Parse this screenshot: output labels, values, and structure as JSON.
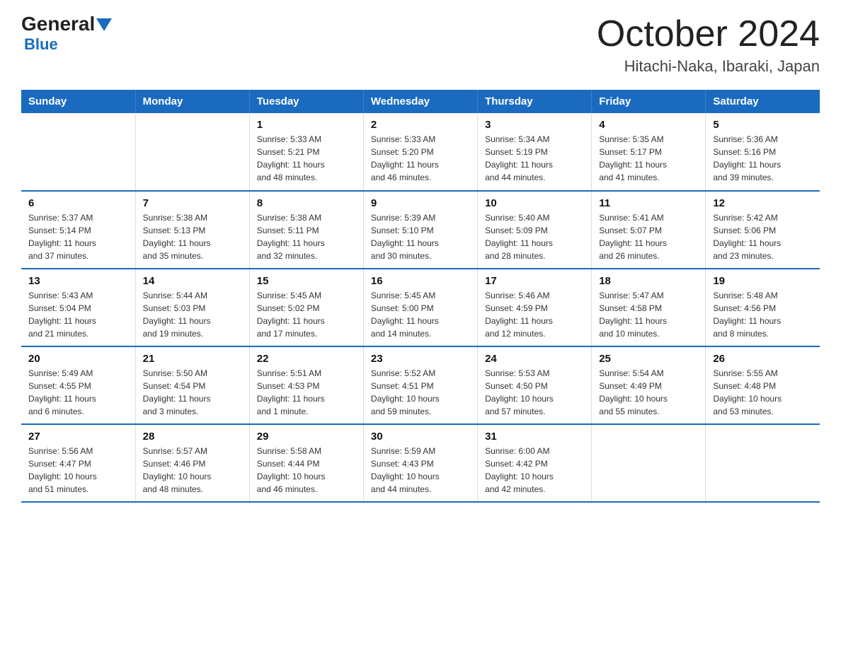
{
  "header": {
    "logo_general": "General",
    "logo_blue": "Blue",
    "month_title": "October 2024",
    "location": "Hitachi-Naka, Ibaraki, Japan"
  },
  "days_of_week": [
    "Sunday",
    "Monday",
    "Tuesday",
    "Wednesday",
    "Thursday",
    "Friday",
    "Saturday"
  ],
  "weeks": [
    [
      {
        "day": "",
        "info": ""
      },
      {
        "day": "",
        "info": ""
      },
      {
        "day": "1",
        "info": "Sunrise: 5:33 AM\nSunset: 5:21 PM\nDaylight: 11 hours\nand 48 minutes."
      },
      {
        "day": "2",
        "info": "Sunrise: 5:33 AM\nSunset: 5:20 PM\nDaylight: 11 hours\nand 46 minutes."
      },
      {
        "day": "3",
        "info": "Sunrise: 5:34 AM\nSunset: 5:19 PM\nDaylight: 11 hours\nand 44 minutes."
      },
      {
        "day": "4",
        "info": "Sunrise: 5:35 AM\nSunset: 5:17 PM\nDaylight: 11 hours\nand 41 minutes."
      },
      {
        "day": "5",
        "info": "Sunrise: 5:36 AM\nSunset: 5:16 PM\nDaylight: 11 hours\nand 39 minutes."
      }
    ],
    [
      {
        "day": "6",
        "info": "Sunrise: 5:37 AM\nSunset: 5:14 PM\nDaylight: 11 hours\nand 37 minutes."
      },
      {
        "day": "7",
        "info": "Sunrise: 5:38 AM\nSunset: 5:13 PM\nDaylight: 11 hours\nand 35 minutes."
      },
      {
        "day": "8",
        "info": "Sunrise: 5:38 AM\nSunset: 5:11 PM\nDaylight: 11 hours\nand 32 minutes."
      },
      {
        "day": "9",
        "info": "Sunrise: 5:39 AM\nSunset: 5:10 PM\nDaylight: 11 hours\nand 30 minutes."
      },
      {
        "day": "10",
        "info": "Sunrise: 5:40 AM\nSunset: 5:09 PM\nDaylight: 11 hours\nand 28 minutes."
      },
      {
        "day": "11",
        "info": "Sunrise: 5:41 AM\nSunset: 5:07 PM\nDaylight: 11 hours\nand 26 minutes."
      },
      {
        "day": "12",
        "info": "Sunrise: 5:42 AM\nSunset: 5:06 PM\nDaylight: 11 hours\nand 23 minutes."
      }
    ],
    [
      {
        "day": "13",
        "info": "Sunrise: 5:43 AM\nSunset: 5:04 PM\nDaylight: 11 hours\nand 21 minutes."
      },
      {
        "day": "14",
        "info": "Sunrise: 5:44 AM\nSunset: 5:03 PM\nDaylight: 11 hours\nand 19 minutes."
      },
      {
        "day": "15",
        "info": "Sunrise: 5:45 AM\nSunset: 5:02 PM\nDaylight: 11 hours\nand 17 minutes."
      },
      {
        "day": "16",
        "info": "Sunrise: 5:45 AM\nSunset: 5:00 PM\nDaylight: 11 hours\nand 14 minutes."
      },
      {
        "day": "17",
        "info": "Sunrise: 5:46 AM\nSunset: 4:59 PM\nDaylight: 11 hours\nand 12 minutes."
      },
      {
        "day": "18",
        "info": "Sunrise: 5:47 AM\nSunset: 4:58 PM\nDaylight: 11 hours\nand 10 minutes."
      },
      {
        "day": "19",
        "info": "Sunrise: 5:48 AM\nSunset: 4:56 PM\nDaylight: 11 hours\nand 8 minutes."
      }
    ],
    [
      {
        "day": "20",
        "info": "Sunrise: 5:49 AM\nSunset: 4:55 PM\nDaylight: 11 hours\nand 6 minutes."
      },
      {
        "day": "21",
        "info": "Sunrise: 5:50 AM\nSunset: 4:54 PM\nDaylight: 11 hours\nand 3 minutes."
      },
      {
        "day": "22",
        "info": "Sunrise: 5:51 AM\nSunset: 4:53 PM\nDaylight: 11 hours\nand 1 minute."
      },
      {
        "day": "23",
        "info": "Sunrise: 5:52 AM\nSunset: 4:51 PM\nDaylight: 10 hours\nand 59 minutes."
      },
      {
        "day": "24",
        "info": "Sunrise: 5:53 AM\nSunset: 4:50 PM\nDaylight: 10 hours\nand 57 minutes."
      },
      {
        "day": "25",
        "info": "Sunrise: 5:54 AM\nSunset: 4:49 PM\nDaylight: 10 hours\nand 55 minutes."
      },
      {
        "day": "26",
        "info": "Sunrise: 5:55 AM\nSunset: 4:48 PM\nDaylight: 10 hours\nand 53 minutes."
      }
    ],
    [
      {
        "day": "27",
        "info": "Sunrise: 5:56 AM\nSunset: 4:47 PM\nDaylight: 10 hours\nand 51 minutes."
      },
      {
        "day": "28",
        "info": "Sunrise: 5:57 AM\nSunset: 4:46 PM\nDaylight: 10 hours\nand 48 minutes."
      },
      {
        "day": "29",
        "info": "Sunrise: 5:58 AM\nSunset: 4:44 PM\nDaylight: 10 hours\nand 46 minutes."
      },
      {
        "day": "30",
        "info": "Sunrise: 5:59 AM\nSunset: 4:43 PM\nDaylight: 10 hours\nand 44 minutes."
      },
      {
        "day": "31",
        "info": "Sunrise: 6:00 AM\nSunset: 4:42 PM\nDaylight: 10 hours\nand 42 minutes."
      },
      {
        "day": "",
        "info": ""
      },
      {
        "day": "",
        "info": ""
      }
    ]
  ]
}
